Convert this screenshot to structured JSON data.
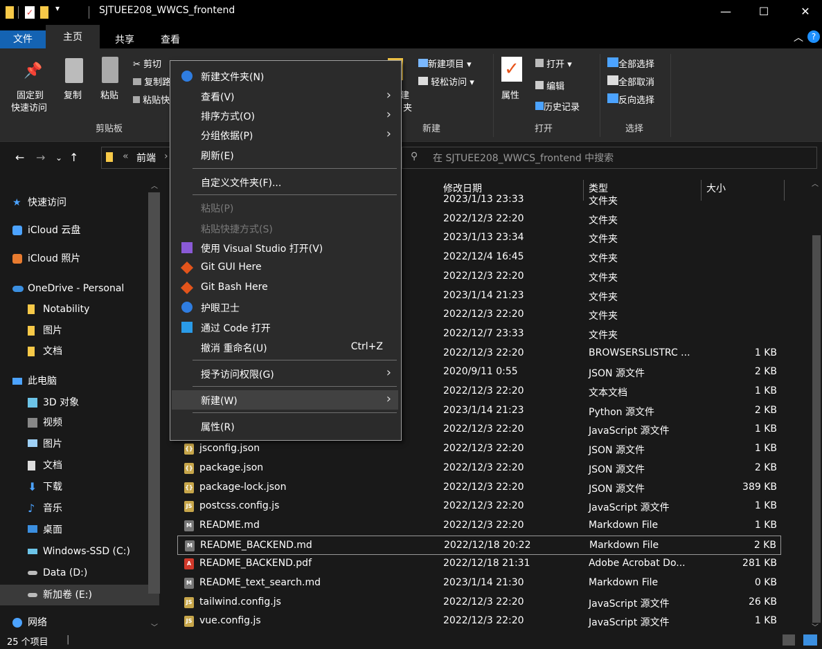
{
  "window": {
    "title": "SJTUEE208_WWCS_frontend",
    "min_glyph": "—",
    "max_glyph": "☐",
    "close_glyph": "✕"
  },
  "ribbon_tabs": [
    "文件",
    "主页",
    "共享",
    "查看"
  ],
  "ribbon": {
    "pin_label_1": "固定到",
    "pin_label_2": "快速访问",
    "copy_label": "复制",
    "paste_label": "粘贴",
    "cut_label": "剪切",
    "copy_path_label": "复制路",
    "paste_shortcut_label": "粘贴快",
    "clipboard_group": "剪贴板",
    "new_folder_partial_1": "建",
    "new_folder_partial_2": "夹",
    "new_item_label": "新建项目",
    "easy_access_label": "轻松访问",
    "new_group": "新建",
    "properties_label": "属性",
    "open_label": "打开",
    "edit_label": "编辑",
    "history_label": "历史记录",
    "open_group": "打开",
    "select_all_label": "全部选择",
    "select_none_label": "全部取消",
    "invert_label": "反向选择",
    "select_group": "选择"
  },
  "address": {
    "breadcrumb_prefix": "«",
    "breadcrumb": "前端",
    "breadcrumb_sep": "›",
    "search_placeholder": "在 SJTUEE208_WWCS_frontend 中搜索"
  },
  "sidebar": {
    "items": [
      {
        "label": "快速访问"
      },
      {
        "label": "iCloud 云盘"
      },
      {
        "label": "iCloud 照片"
      },
      {
        "label": "OneDrive - Personal"
      },
      {
        "label": "Notability"
      },
      {
        "label": "图片"
      },
      {
        "label": "文档"
      },
      {
        "label": "此电脑"
      },
      {
        "label": "3D 对象"
      },
      {
        "label": "视频"
      },
      {
        "label": "图片"
      },
      {
        "label": "文档"
      },
      {
        "label": "下载"
      },
      {
        "label": "音乐"
      },
      {
        "label": "桌面"
      },
      {
        "label": "Windows-SSD (C:)"
      },
      {
        "label": "Data (D:)"
      },
      {
        "label": "新加卷 (E:)"
      },
      {
        "label": "网络"
      }
    ]
  },
  "columns": {
    "date": "修改日期",
    "type": "类型",
    "size": "大小"
  },
  "files": [
    {
      "name": "",
      "date": "2023/1/13 23:33",
      "type": "文件夹",
      "size": ""
    },
    {
      "name": "",
      "date": "2022/12/3 22:20",
      "type": "文件夹",
      "size": ""
    },
    {
      "name": "",
      "date": "2023/1/13 23:34",
      "type": "文件夹",
      "size": ""
    },
    {
      "name": "",
      "date": "2022/12/4 16:45",
      "type": "文件夹",
      "size": ""
    },
    {
      "name": "",
      "date": "2022/12/3 22:20",
      "type": "文件夹",
      "size": ""
    },
    {
      "name": "",
      "date": "2023/1/14 21:23",
      "type": "文件夹",
      "size": ""
    },
    {
      "name": "",
      "date": "2022/12/3 22:20",
      "type": "文件夹",
      "size": ""
    },
    {
      "name": "",
      "date": "2022/12/7 23:33",
      "type": "文件夹",
      "size": ""
    },
    {
      "name": "",
      "date": "2022/12/3 22:20",
      "type": "BROWSERSLISTRC ...",
      "size": "1 KB"
    },
    {
      "name": "",
      "date": "2020/9/11 0:55",
      "type": "JSON 源文件",
      "size": "2 KB"
    },
    {
      "name": "",
      "date": "2022/12/3 22:20",
      "type": "文本文档",
      "size": "1 KB"
    },
    {
      "name": "",
      "date": "2023/1/14 21:23",
      "type": "Python 源文件",
      "size": "2 KB"
    },
    {
      "name": "",
      "date": "2022/12/3 22:20",
      "type": "JavaScript 源文件",
      "size": "1 KB"
    },
    {
      "name": "jsconfig.json",
      "date": "2022/12/3 22:20",
      "type": "JSON 源文件",
      "size": "1 KB"
    },
    {
      "name": "package.json",
      "date": "2022/12/3 22:20",
      "type": "JSON 源文件",
      "size": "2 KB"
    },
    {
      "name": "package-lock.json",
      "date": "2022/12/3 22:20",
      "type": "JSON 源文件",
      "size": "389 KB"
    },
    {
      "name": "postcss.config.js",
      "date": "2022/12/3 22:20",
      "type": "JavaScript 源文件",
      "size": "1 KB"
    },
    {
      "name": "README.md",
      "date": "2022/12/3 22:20",
      "type": "Markdown File",
      "size": "1 KB"
    },
    {
      "name": "README_BACKEND.md",
      "date": "2022/12/18 20:22",
      "type": "Markdown File",
      "size": "2 KB"
    },
    {
      "name": "README_BACKEND.pdf",
      "date": "2022/12/18 21:31",
      "type": "Adobe Acrobat Do...",
      "size": "281 KB"
    },
    {
      "name": "README_text_search.md",
      "date": "2023/1/14 21:30",
      "type": "Markdown File",
      "size": "0 KB"
    },
    {
      "name": "tailwind.config.js",
      "date": "2022/12/3 22:20",
      "type": "JavaScript 源文件",
      "size": "26 KB"
    },
    {
      "name": "vue.config.js",
      "date": "2022/12/3 22:20",
      "type": "JavaScript 源文件",
      "size": "1 KB"
    }
  ],
  "status": {
    "count": "25 个项目"
  },
  "context_menu": {
    "new_folder": "新建文件夹(N)",
    "view": "查看(V)",
    "sort": "排序方式(O)",
    "group": "分组依据(P)",
    "refresh": "刷新(E)",
    "customize": "自定义文件夹(F)...",
    "paste": "粘贴(P)",
    "paste_shortcut": "粘贴快捷方式(S)",
    "open_vs": "使用 Visual Studio 打开(V)",
    "git_gui": "Git GUI Here",
    "git_bash": "Git Bash Here",
    "eye_guard": "护眼卫士",
    "open_code": "通过 Code 打开",
    "undo_rename": "撤消 重命名(U)",
    "undo_shortcut": "Ctrl+Z",
    "grant_access": "授予访问权限(G)",
    "new": "新建(W)",
    "properties": "属性(R)"
  }
}
